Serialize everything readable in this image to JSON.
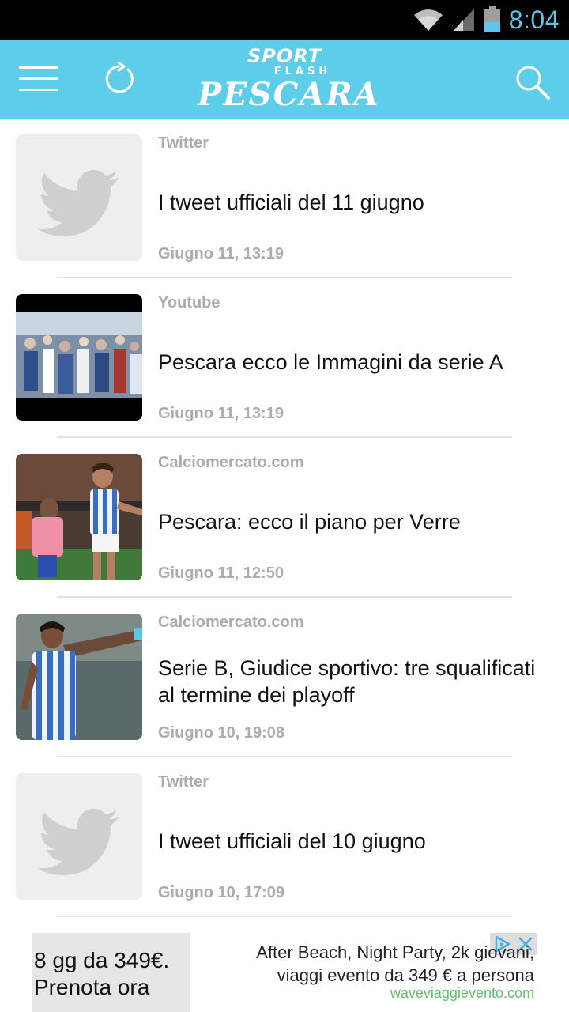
{
  "status_bar": {
    "time": "8:04",
    "wifi_icon": "wifi-icon",
    "signal_icon": "signal-icon",
    "battery_icon": "battery-icon"
  },
  "app_bar": {
    "logo_line1": "SPORT",
    "logo_line2": "FLASH",
    "logo_line3": "PESCARA",
    "menu_icon": "hamburger-menu-icon",
    "refresh_icon": "refresh-icon",
    "search_icon": "search-icon",
    "accent_color": "#5ecde9"
  },
  "feed": {
    "items": [
      {
        "source": "Twitter",
        "title": "I tweet ufficiali del 11 giugno",
        "date": "Giugno 11, 13:19",
        "thumb": "twitter-placeholder"
      },
      {
        "source": "Youtube",
        "title": "Pescara ecco le Immagini da serie A",
        "date": "Giugno 11, 13:19",
        "thumb": "crowd-photo"
      },
      {
        "source": "Calciomercato.com",
        "title": "Pescara: ecco il piano per Verre",
        "date": "Giugno 11, 12:50",
        "thumb": "player-celebration-photo"
      },
      {
        "source": "Calciomercato.com",
        "title": "Serie B, Giudice sportivo: tre squalificati al termine dei playoff",
        "date": "Giugno 10, 19:08",
        "thumb": "player-pointing-photo"
      },
      {
        "source": "Twitter",
        "title": "I tweet ufficiali del 10 giugno",
        "date": "Giugno 10, 17:09",
        "thumb": "twitter-placeholder"
      }
    ]
  },
  "ad": {
    "left_text_line1": "8 gg da 349€.",
    "left_text_line2": "Prenota ora",
    "headline_line1": "After Beach, Night Party, 2k giovani,",
    "headline_line2": "viaggi evento da 349 € a persona",
    "url": "waveviaggievento.com"
  }
}
